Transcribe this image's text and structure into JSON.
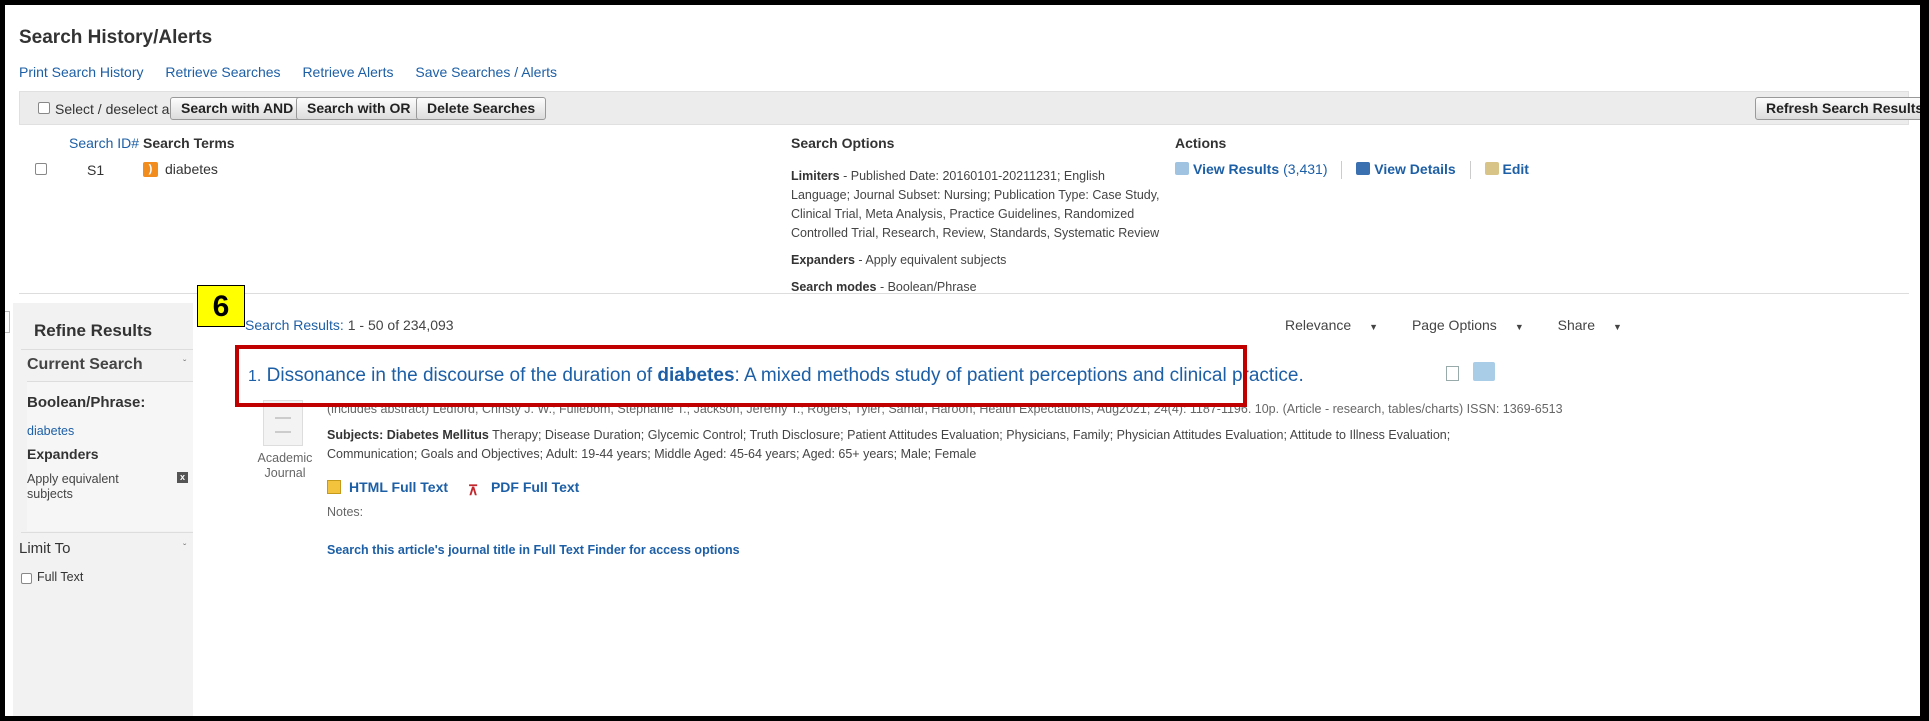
{
  "search_history": {
    "title": "Search History/Alerts",
    "links": [
      "Print Search History",
      "Retrieve Searches",
      "Retrieve Alerts",
      "Save Searches / Alerts"
    ],
    "toolbar": {
      "select_all_label": "Select / deselect all",
      "and_button": "Search with AND",
      "or_button": "Search with OR",
      "delete_button": "Delete Searches",
      "refresh_button": "Refresh Search Results"
    },
    "columns": {
      "id": "Search ID#",
      "terms": "Search Terms",
      "options": "Search Options",
      "actions": "Actions"
    },
    "row": {
      "id": "S1",
      "term": "diabetes",
      "limiters_label": "Limiters",
      "limiters": "- Published Date: 20160101-20211231; English Language; Journal Subset: Nursing; Publication Type: Case Study, Clinical Trial, Meta Analysis, Practice Guidelines, Randomized Controlled Trial, Research, Review, Standards, Systematic Review",
      "expanders_label": "Expanders",
      "expanders": "- Apply equivalent subjects",
      "modes_label": "Search modes",
      "modes": "- Boolean/Phrase",
      "view_results": "View Results",
      "result_count": "(3,431)",
      "view_details": "View Details",
      "edit": "Edit"
    }
  },
  "refine": {
    "title": "Refine Results",
    "current_search": "Current Search",
    "boolean_phrase": "Boolean/Phrase:",
    "term": "diabetes",
    "expanders": "Expanders",
    "expander_value": "Apply equivalent subjects",
    "limit_to": "Limit To",
    "full_text": "Full Text"
  },
  "results": {
    "count_label": "Search Results:",
    "count": "1 - 50 of 234,093",
    "sort": "Relevance",
    "page_options": "Page Options",
    "share": "Share",
    "item": {
      "number": "1.",
      "title_before": "Dissonance in the discourse of the duration of ",
      "title_bold": "diabetes",
      "title_after": ": A mixed methods study of patient perceptions and clinical practice.",
      "meta": "(includes abstract) Ledford, Christy J. W.; Fullebom, Stephanie T.; Jackson, Jeremy T.; Rogers, Tyler; Samar, Haroon; Health Expectations, Aug2021; 24(4): 1187-1196. 10p. (Article - research, tables/charts) ISSN: 1369-6513",
      "subjects_label": "Subjects:",
      "subjects_major": "Diabetes Mellitus",
      "subjects_rest": " Therapy; Disease Duration; Glycemic Control; Truth Disclosure; Patient Attitudes Evaluation; Physicians, Family; Physician Attitudes Evaluation; Attitude to Illness Evaluation; Communication; Goals and Objectives; Adult: 19-44 years; Middle Aged: 45-64 years; Aged: 65+ years; Male; Female",
      "doc_type": "Academic Journal",
      "html_link": "HTML Full Text",
      "pdf_link": "PDF Full Text",
      "notes": "Notes:",
      "finder_link": "Search this article's journal title in Full Text Finder for access options"
    }
  },
  "annotation": {
    "step": "6",
    "highlight_color": "#c00000",
    "badge_color": "#ffff00"
  }
}
